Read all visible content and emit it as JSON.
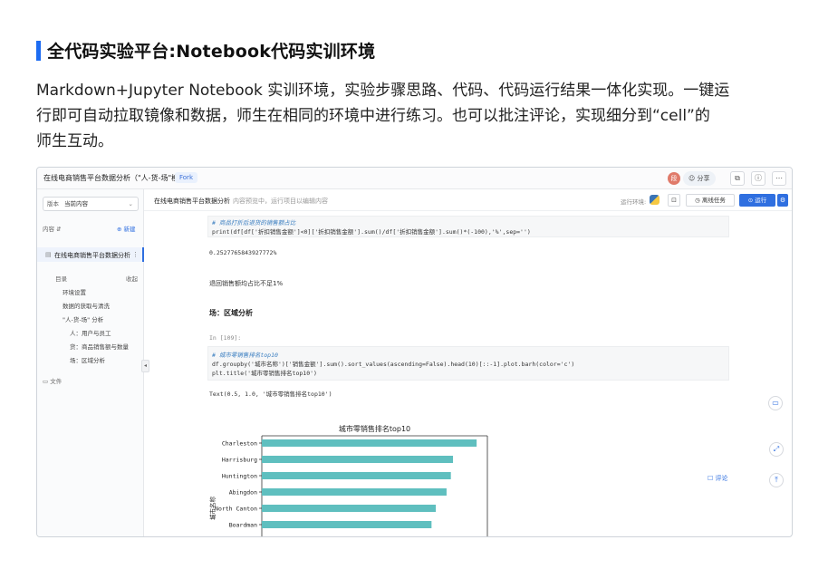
{
  "heading": "全代码实验平台:Notebook代码实训环境",
  "intro": [
    "Markdown+Jupyter Notebook 实训环境，实验步骤思路、代码、代码运行结果一体化实现。一键运",
    "行即可自动拉取镜像和数据，师生在相同的环境中进行练习。也可以批注评论，实现细分到“cell”的",
    "师生互动。"
  ],
  "app": {
    "title": "在线电商销售平台数据分析（\"人-货-场\"模型）",
    "fork_label": "Fork",
    "avatar_letter": "段",
    "share_label": "分享",
    "top_icons": [
      "external-link-icon",
      "info-icon",
      "more-icon"
    ],
    "top_glyphs": [
      "⧉",
      "ⓘ",
      "⋯"
    ]
  },
  "sidebar": {
    "version_label": "版本",
    "version_value": "当前内容",
    "content_label": "内容",
    "new_label": "新建",
    "file_name": "在线电商销售平台数据分析",
    "toc_label": "目录",
    "collapse_label": "收起",
    "toc": [
      {
        "label": "环境设置",
        "level": 1
      },
      {
        "label": "数据的获取与清洗",
        "level": 1
      },
      {
        "label": "\"人-货-场\" 分析",
        "level": 1
      },
      {
        "label": "人：用户与员工",
        "level": 2
      },
      {
        "label": "货：商品销售额与数量",
        "level": 2
      },
      {
        "label": "场：区域分析",
        "level": 2
      }
    ],
    "files_label": "文件"
  },
  "notebook": {
    "title": "在线电商销售平台数据分析",
    "hint": "内容预览中，运行项目以编辑内容",
    "env_label": "运行环境:",
    "offline_label": "离线任务",
    "run_label": "运行"
  },
  "cells": {
    "code1_comment": "# 商品打折后退货的销售额占比",
    "code1_line": "print(df[df['折扣销售金额']<0]['折扣销售金额'].sum()/df['折扣销售金额'].sum()*(-100),'%',sep='')",
    "out1": "0.2527765843927772%",
    "text1": "退回销售额均占比不足1%",
    "comment_label": "评论",
    "section": "场：区域分析",
    "prompt2": "In [109]:",
    "code2_comment": "# 城市零销售排名top10",
    "code2_line1": "df.groupby('城市名称')['销售金额'].sum().sort_values(ascending=False).head(10)[::-1].plot.barh(color='c')",
    "code2_line2": "plt.title('城市零销售排名top10')",
    "out2": "Text(0.5, 1.0, '城市零销售排名top10')"
  },
  "chart_data": {
    "type": "bar",
    "orientation": "horizontal",
    "title": "城市零销售排名top10",
    "ylabel": "城市名称",
    "categories": [
      "Charleston",
      "Harrisburg",
      "Huntington",
      "Abingdon",
      "North Canton",
      "Boardman"
    ],
    "values": [
      100,
      89,
      88,
      86,
      81,
      79
    ],
    "color": "#5fbfbf"
  }
}
